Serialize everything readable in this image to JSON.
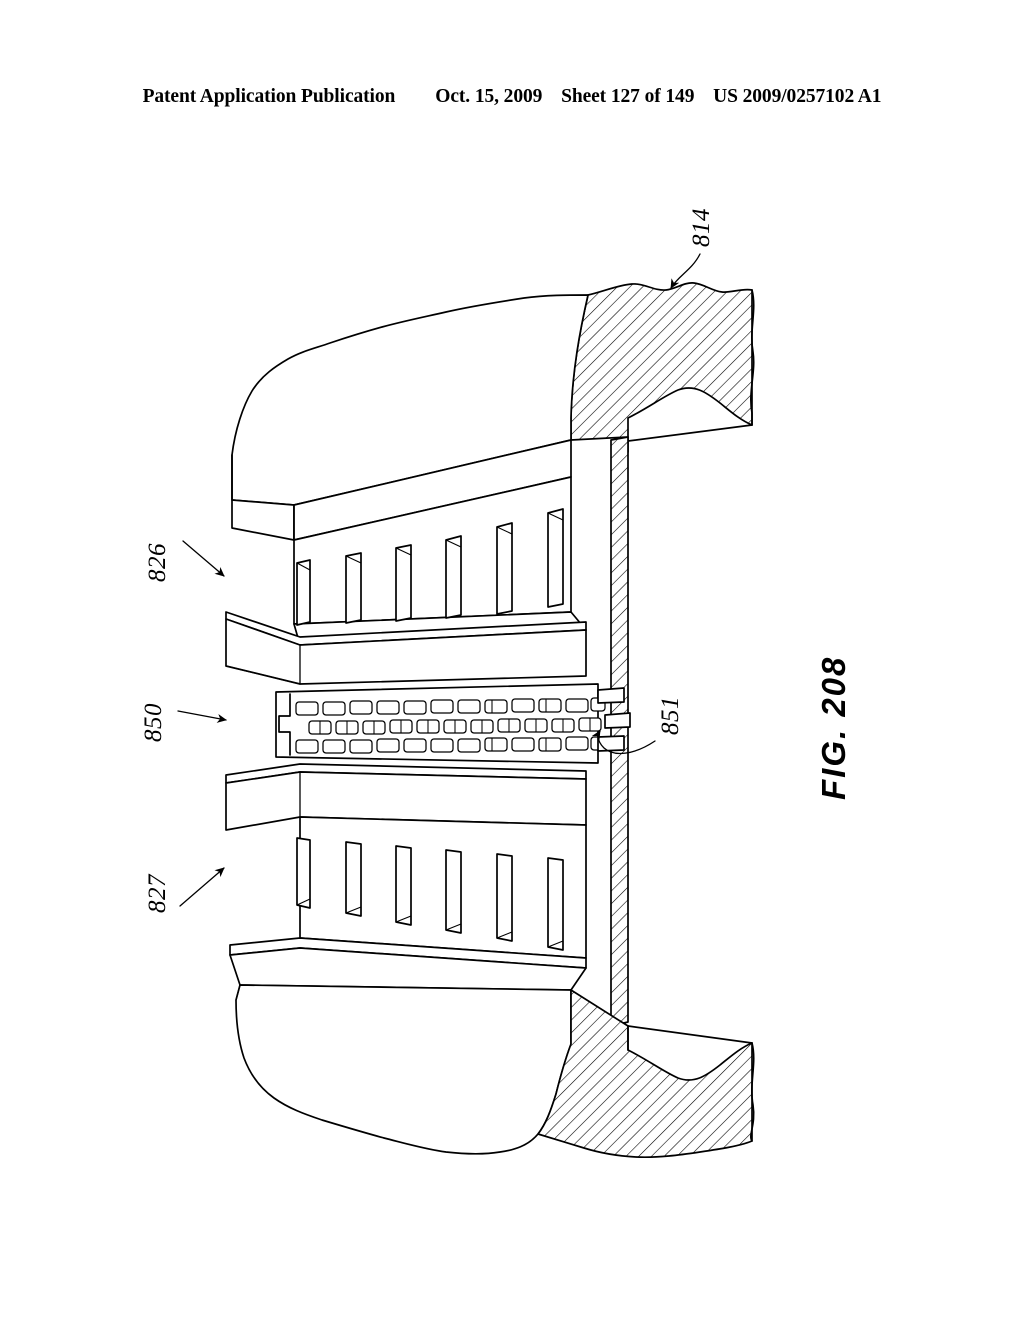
{
  "header": {
    "publication": "Patent Application Publication",
    "date": "Oct. 15, 2009",
    "sheet": "Sheet 127 of 149",
    "document_number": "US 2009/0257102 A1"
  },
  "figure": {
    "label": "FIG. 208",
    "description": "Isometric cutaway view of an inkjet printhead nozzle assembly showing upper and lower fin arrays, a perforated nozzle plate, and cross-hatched substrate material",
    "line_color": "#000000",
    "background_color": "#ffffff"
  },
  "reference_numerals": [
    {
      "id": "814",
      "label": "814",
      "description": "cross-hatched substrate / moulding material",
      "leader": "curved-line-with-arrowhead",
      "position": "upper-right"
    },
    {
      "id": "826",
      "label": "826",
      "description": "upper fin / rib array in channel",
      "leader": "straight-arrow",
      "position": "upper-left"
    },
    {
      "id": "850",
      "label": "850",
      "description": "perforated nozzle plate with aperture rows",
      "leader": "straight-arrow",
      "position": "middle-left"
    },
    {
      "id": "851",
      "label": "851",
      "description": "individual nozzle aperture detail",
      "leader": "curved-line-with-arrowhead",
      "position": "middle-right"
    },
    {
      "id": "827",
      "label": "827",
      "description": "lower fin / rib array in channel",
      "leader": "straight-arrow",
      "position": "lower-left"
    }
  ],
  "nozzle_plate": {
    "row_count": 3,
    "apertures_per_row": 12,
    "row_labels": [
      "top-row",
      "middle-row",
      "bottom-row"
    ]
  },
  "fin_arrays": {
    "upper_fin_count": 6,
    "lower_fin_count": 6
  }
}
